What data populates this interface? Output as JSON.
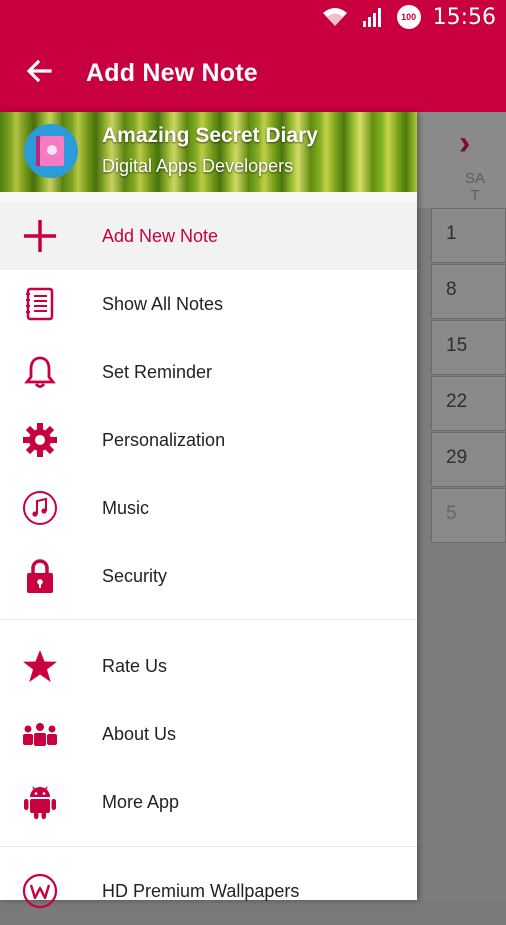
{
  "status_bar": {
    "battery_badge": "100",
    "time": "15:56"
  },
  "app_bar": {
    "title": "Add New Note"
  },
  "drawer": {
    "header": {
      "app_name": "Amazing Secret Diary",
      "developer": "Digital Apps Developers"
    },
    "items": [
      {
        "label": "Add New Note",
        "icon": "plus-icon",
        "active": true
      },
      {
        "label": "Show All Notes",
        "icon": "notebook-icon"
      },
      {
        "label": "Set Reminder",
        "icon": "bell-icon"
      },
      {
        "label": "Personalization",
        "icon": "gear-icon"
      },
      {
        "label": "Music",
        "icon": "music-note-icon"
      },
      {
        "label": "Security",
        "icon": "lock-icon"
      },
      {
        "label": "Rate Us",
        "icon": "star-icon"
      },
      {
        "label": "About Us",
        "icon": "people-icon"
      },
      {
        "label": "More App",
        "icon": "android-icon"
      },
      {
        "label": "HD Premium Wallpapers",
        "icon": "wallpaper-w-icon"
      }
    ]
  },
  "calendar": {
    "day_header": "SA\nT",
    "dates": [
      "1",
      "8",
      "15",
      "22",
      "29",
      "5"
    ]
  },
  "colors": {
    "accent": "#c8003f",
    "icon": "#c8003f"
  }
}
